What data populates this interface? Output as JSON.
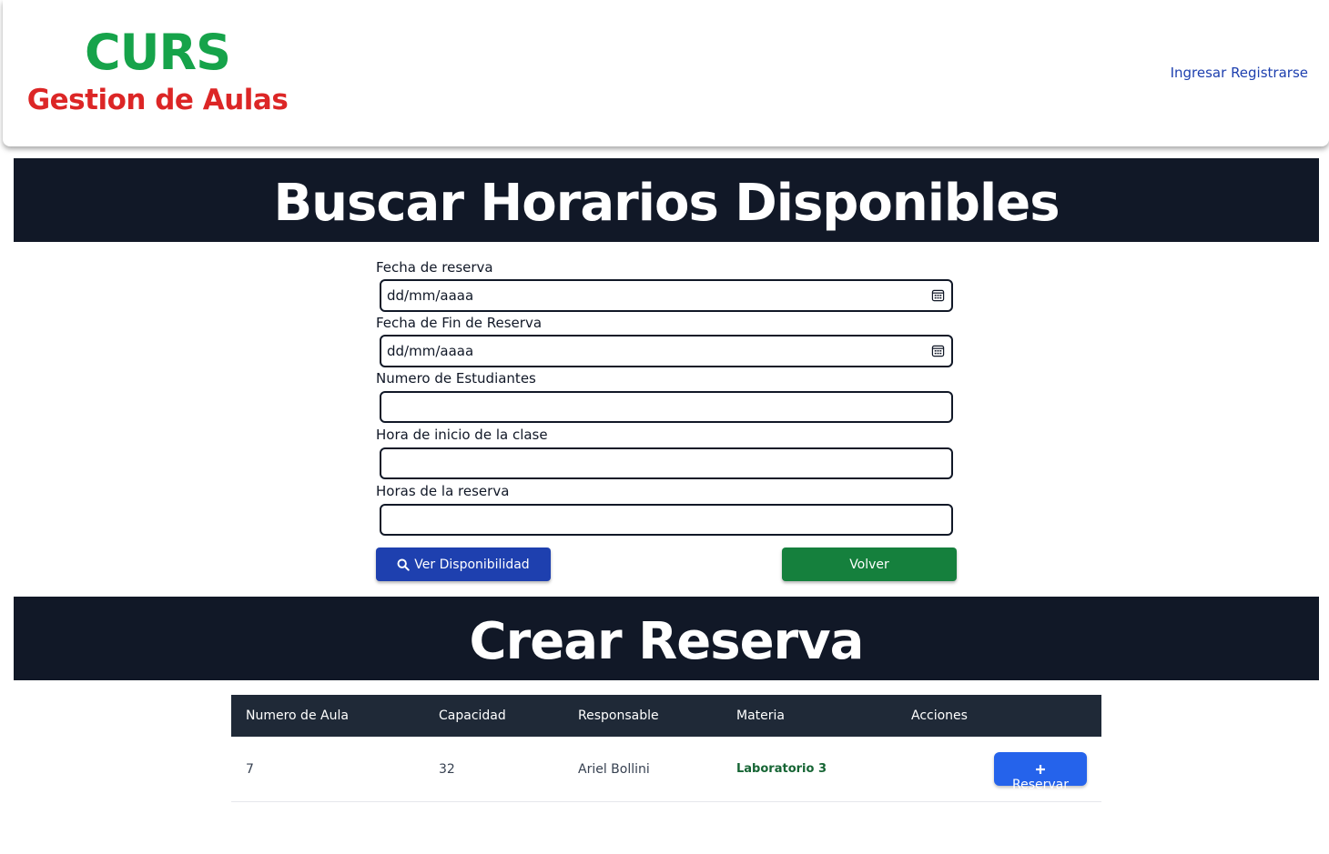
{
  "header": {
    "brand_title": "CURS",
    "brand_subtitle": "Gestion de Aulas",
    "nav": {
      "login": "Ingresar",
      "register": "Registrarse"
    }
  },
  "search_section": {
    "title": "Buscar Horarios Disponibles",
    "fields": [
      {
        "label": "Fecha de reserva",
        "placeholder": "dd/mm/aaaa",
        "type": "date"
      },
      {
        "label": "Fecha de Fin de Reserva",
        "placeholder": "dd/mm/aaaa",
        "type": "date"
      },
      {
        "label": "Numero de Estudiantes",
        "value": ""
      },
      {
        "label": "Hora de inicio de la clase",
        "value": ""
      },
      {
        "label": "Horas de la reserva",
        "value": ""
      }
    ],
    "buttons": {
      "search": "Ver Disponibilidad",
      "back": "Volver"
    }
  },
  "reserve_section": {
    "title": "Crear Reserva",
    "table": {
      "headers": [
        "Numero de Aula",
        "Capacidad",
        "Responsable",
        "Materia",
        "Acciones"
      ],
      "rows": [
        {
          "aula": "7",
          "capacidad": "32",
          "responsable": "Ariel Bollini",
          "materia": "Laboratorio 3",
          "action": "Reservar"
        }
      ]
    }
  },
  "colors": {
    "brand_green": "#16a34a",
    "brand_red": "#dc2626",
    "banner_bg": "#111827",
    "primary_blue": "#1e40af",
    "secondary_green": "#15803d",
    "reserve_blue": "#2563eb"
  },
  "icons": {
    "search_button": "search-icon",
    "reserve_button": "plus-icon",
    "date_field": "calendar-icon"
  }
}
